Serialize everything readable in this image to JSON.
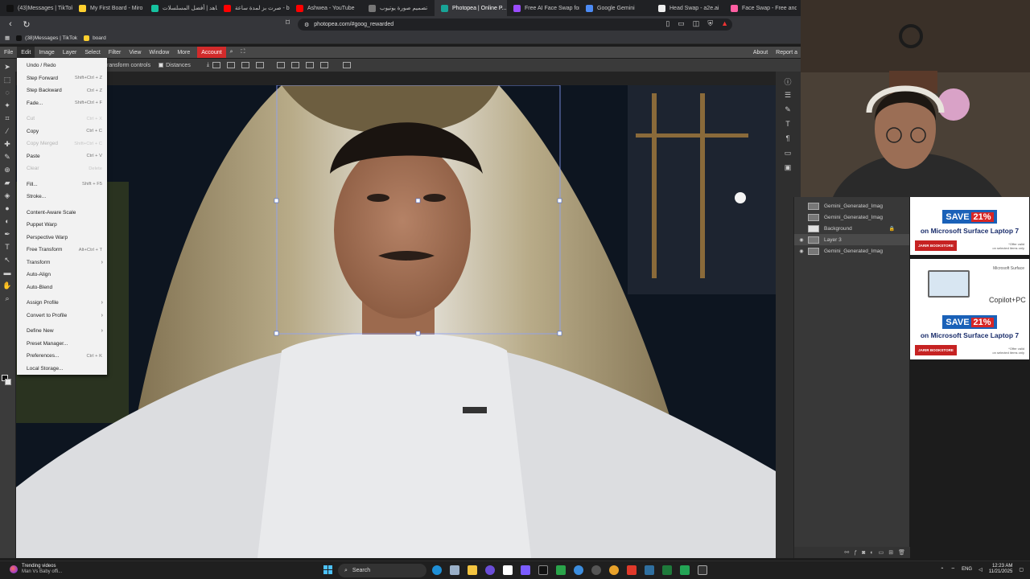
{
  "browser": {
    "tabs": [
      {
        "label": "(43)Messages | TikTok",
        "color": "#111111",
        "active": false
      },
      {
        "label": "My First Board - Miro",
        "color": "#ffd02f",
        "active": false
      },
      {
        "label": "شاهد | أفضل المسلسلات",
        "color": "#16c2a0",
        "active": false
      },
      {
        "label": "صرت بز لمدة ساعة - bel...",
        "color": "#ff0000",
        "active": false
      },
      {
        "label": "Ashwea - YouTube",
        "color": "#ff0000",
        "active": false
      },
      {
        "label": "تصميم صورة يوتيوب",
        "color": "#777777",
        "active": false
      },
      {
        "label": "Photopea | Online P...",
        "color": "#18a497",
        "active": true
      },
      {
        "label": "Free AI Face Swap for Pr...",
        "color": "#9b4dff",
        "active": false
      },
      {
        "label": "Google Gemini",
        "color": "#4c8bf5",
        "active": false
      },
      {
        "label": "Head Swap - a2e.ai",
        "color": "#eeeeee",
        "active": false
      },
      {
        "label": "Face Swap - Free and Un...",
        "color": "#ff5fa2",
        "active": false
      }
    ],
    "url": "photopea.com/#goog_rewarded",
    "bookmarks": [
      {
        "label": "(38)Messages | TikTok",
        "color": "#111111"
      },
      {
        "label": "board",
        "color": "#ffd02f"
      }
    ]
  },
  "photopea": {
    "menus": [
      "File",
      "Edit",
      "Image",
      "Layer",
      "Select",
      "Filter",
      "View",
      "Window",
      "More"
    ],
    "account_label": "Account",
    "right_links": [
      "About",
      "Report a"
    ],
    "options": {
      "transform_controls": "ransform controls",
      "distances": "Distances"
    },
    "edit_menu": [
      {
        "label": "Undo / Redo",
        "shortcut": "",
        "disabled": false
      },
      {
        "label": "Step Forward",
        "shortcut": "Shift+Ctrl + Z",
        "disabled": false
      },
      {
        "label": "Step Backward",
        "shortcut": "Ctrl + Z",
        "disabled": false
      },
      {
        "label": "Fade...",
        "shortcut": "Shift+Ctrl + F",
        "disabled": false
      },
      {
        "sep": true
      },
      {
        "label": "Cut",
        "shortcut": "Ctrl + X",
        "disabled": true
      },
      {
        "label": "Copy",
        "shortcut": "Ctrl + C",
        "disabled": false
      },
      {
        "label": "Copy Merged",
        "shortcut": "Shift+Ctrl + C",
        "disabled": true
      },
      {
        "label": "Paste",
        "shortcut": "Ctrl + V",
        "disabled": false
      },
      {
        "label": "Clear",
        "shortcut": "Delete",
        "disabled": true
      },
      {
        "sep": true
      },
      {
        "label": "Fill...",
        "shortcut": "Shift + F5",
        "disabled": false
      },
      {
        "label": "Stroke...",
        "shortcut": "",
        "disabled": false
      },
      {
        "sep": true
      },
      {
        "label": "Content-Aware Scale",
        "shortcut": "",
        "disabled": false
      },
      {
        "label": "Puppet Warp",
        "shortcut": "",
        "disabled": false
      },
      {
        "label": "Perspective Warp",
        "shortcut": "",
        "disabled": false
      },
      {
        "label": "Free Transform",
        "shortcut": "Alt+Ctrl + T",
        "disabled": false
      },
      {
        "label": "Transform",
        "shortcut": "",
        "disabled": false,
        "submenu": true
      },
      {
        "label": "Auto-Align",
        "shortcut": "",
        "disabled": false
      },
      {
        "label": "Auto-Blend",
        "shortcut": "",
        "disabled": false
      },
      {
        "sep": true
      },
      {
        "label": "Assign Profile",
        "shortcut": "",
        "disabled": false,
        "submenu": true
      },
      {
        "label": "Convert to Profile",
        "shortcut": "",
        "disabled": false,
        "submenu": true
      },
      {
        "sep": true
      },
      {
        "label": "Define New",
        "shortcut": "",
        "disabled": false,
        "submenu": true
      },
      {
        "label": "Preset Manager...",
        "shortcut": "",
        "disabled": false
      },
      {
        "label": "Preferences...",
        "shortcut": "Ctrl + K",
        "disabled": false
      },
      {
        "label": "Local Storage...",
        "shortcut": "",
        "disabled": false
      }
    ],
    "layers": [
      {
        "name": "Gemini_Generated_Imag",
        "visible": false,
        "selected": false,
        "bg": false
      },
      {
        "name": "Gemini_Generated_Imag",
        "visible": false,
        "selected": false,
        "bg": false
      },
      {
        "name": "Background",
        "visible": false,
        "selected": false,
        "bg": true,
        "locked": true
      },
      {
        "name": "Layer 3",
        "visible": true,
        "selected": true,
        "bg": false
      },
      {
        "name": "Gemini_Generated_Imag",
        "visible": true,
        "selected": false,
        "bg": false
      }
    ]
  },
  "ads": {
    "save_prefix": "SAVE",
    "save_pct": "21%",
    "line": "on Microsoft Surface Laptop 7",
    "copilot": "Copilot+PC",
    "microsoft": "Microsoft Surface"
  },
  "taskbar": {
    "news_title": "Trending videos",
    "news_sub": "Man Vs Baby offi...",
    "search": "Search",
    "lang": "ENG",
    "time": "12:23 AM",
    "date": "11/21/2025"
  }
}
